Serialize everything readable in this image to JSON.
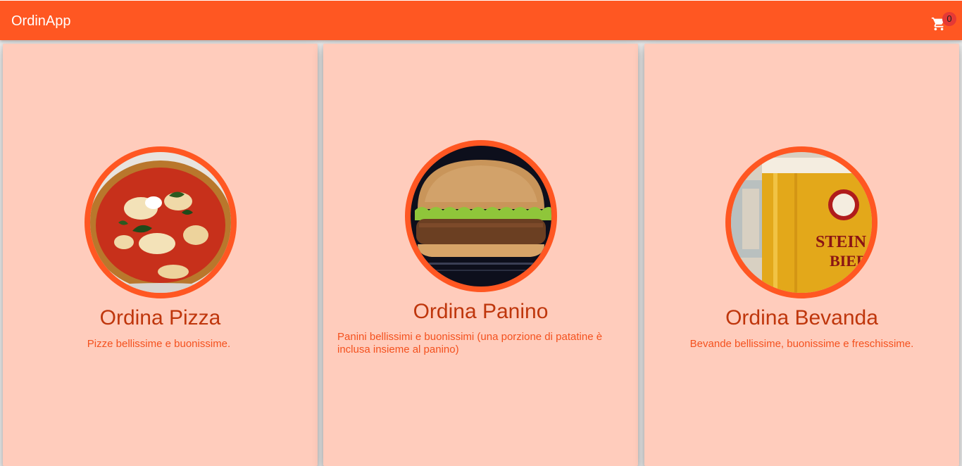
{
  "app": {
    "title": "OrdinApp"
  },
  "cart": {
    "count": "0",
    "icon": "shopping-cart-icon"
  },
  "colors": {
    "primary": "#ff5722",
    "card_bg": "#ffccbc",
    "title": "#bf360c",
    "desc": "#f4511e"
  },
  "cards": [
    {
      "title": "Ordina Pizza",
      "description": "Pizze bellissime e buonissime.",
      "image": "pizza-image"
    },
    {
      "title": "Ordina Panino",
      "description": "Panini bellissimi e buonissimi (una porzione di patatine è inclusa insieme al panino)",
      "image": "burger-image"
    },
    {
      "title": "Ordina Bevanda",
      "description": "Bevande bellissime, buonissime e freschissime.",
      "image": "beer-image"
    }
  ]
}
